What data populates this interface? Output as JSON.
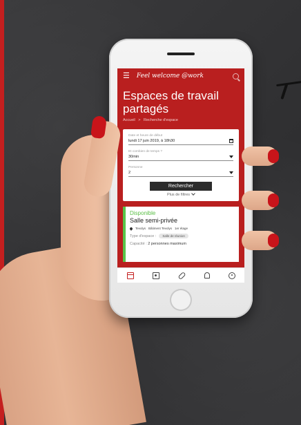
{
  "app": {
    "brand": "Feel welcome @work"
  },
  "page": {
    "title": "Espaces de travail partagés",
    "breadcrumb": [
      "Accueil",
      ">",
      "Recherche d'espace"
    ]
  },
  "form": {
    "date_label": "Date et heure de début",
    "date_value": "lundi 17 juin 2019, à 18h30",
    "duration_label": "Et combien de temps ?",
    "duration_value": "30min",
    "persons_label": "Personne",
    "persons_value": "2",
    "search_button": "Rechercher",
    "more_filters": "Plus de filtres"
  },
  "result": {
    "status": "Disponible",
    "room_name": "Salle semi-privée",
    "location": [
      "Tevolys",
      "Bâtiment Tevolys",
      "1er étage"
    ],
    "type_label": "Type d'espace :",
    "type_value": "Salle de réunion",
    "capacity_label": "Capacité :",
    "capacity_value": "2 personnes maximum"
  },
  "tabbar": {
    "items": [
      "card-icon",
      "badge-icon",
      "link-icon",
      "bell-icon",
      "user-icon"
    ]
  },
  "colors": {
    "brand_red": "#b91f1f",
    "available_green": "#58c44a",
    "button_dark": "#2c2c2c"
  }
}
